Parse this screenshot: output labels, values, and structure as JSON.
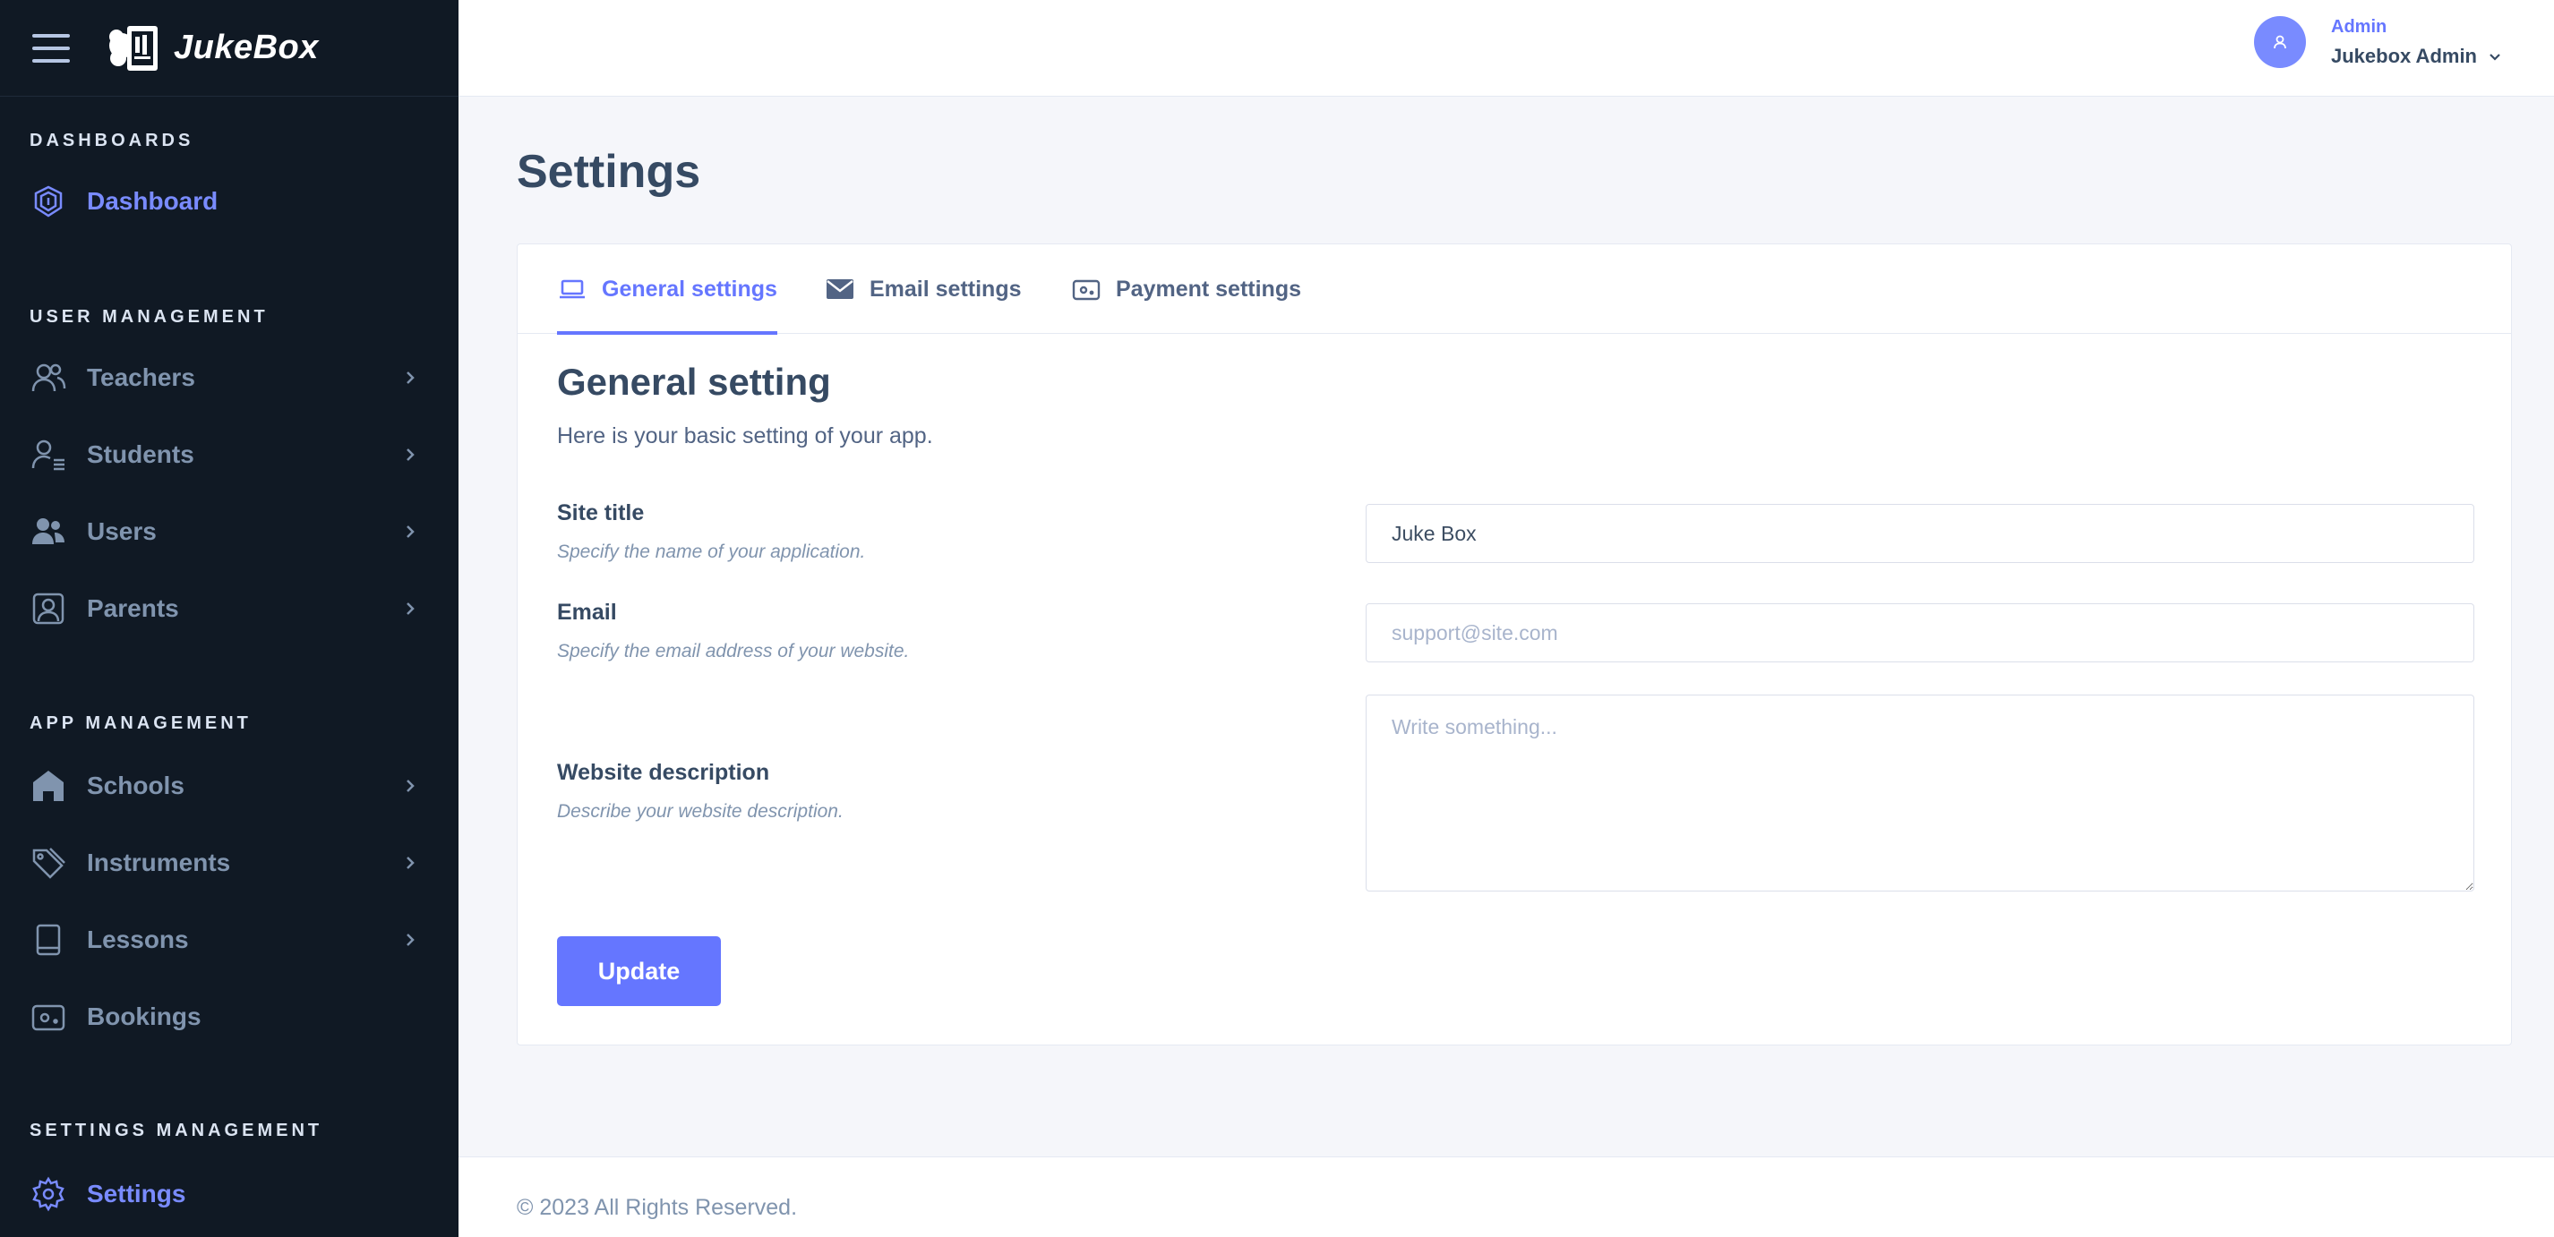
{
  "app": {
    "name": "JukeBox"
  },
  "sidebar": {
    "sections": [
      {
        "title": "DASHBOARDS"
      },
      {
        "title": "USER MANAGEMENT"
      },
      {
        "title": "APP MANAGEMENT"
      },
      {
        "title": "SETTINGS MANAGEMENT"
      }
    ],
    "items": [
      {
        "label": "Dashboard",
        "icon": "dashboard-icon",
        "active": true
      },
      {
        "label": "Teachers",
        "icon": "teachers-icon",
        "has_submenu": true
      },
      {
        "label": "Students",
        "icon": "students-icon",
        "has_submenu": true
      },
      {
        "label": "Users",
        "icon": "users-icon",
        "has_submenu": true
      },
      {
        "label": "Parents",
        "icon": "parents-icon",
        "has_submenu": true
      },
      {
        "label": "Schools",
        "icon": "schools-icon",
        "has_submenu": true
      },
      {
        "label": "Instruments",
        "icon": "instruments-icon",
        "has_submenu": true
      },
      {
        "label": "Lessons",
        "icon": "lessons-icon",
        "has_submenu": true
      },
      {
        "label": "Bookings",
        "icon": "bookings-icon"
      },
      {
        "label": "Settings",
        "icon": "settings-icon",
        "active": true
      }
    ]
  },
  "header": {
    "user_role": "Admin",
    "user_name": "Jukebox Admin"
  },
  "main": {
    "page_title": "Settings",
    "tabs": [
      {
        "label": "General settings",
        "icon": "laptop-icon",
        "active": true
      },
      {
        "label": "Email settings",
        "icon": "envelope-icon"
      },
      {
        "label": "Payment settings",
        "icon": "payment-icon"
      }
    ],
    "section_title": "General setting",
    "section_subtitle": "Here is your basic setting of your app.",
    "fields": {
      "site_title": {
        "label": "Site title",
        "hint": "Specify the name of your application.",
        "value": "Juke Box"
      },
      "email": {
        "label": "Email",
        "hint": "Specify the email address of your website.",
        "placeholder": "support@site.com"
      },
      "description": {
        "label": "Website description",
        "hint": "Describe your website description.",
        "placeholder": "Write something..."
      }
    },
    "update_button": "Update"
  },
  "footer": {
    "copyright": "© 2023 All Rights Reserved."
  },
  "colors": {
    "accent": "#6576ff",
    "sidebar_bg": "#101924",
    "page_bg": "#f5f6fa"
  }
}
